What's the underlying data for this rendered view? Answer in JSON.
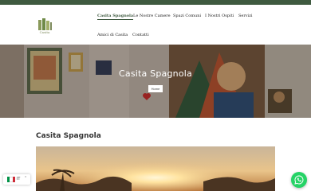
{
  "site": {
    "logo_text": "Casita"
  },
  "nav": {
    "items": [
      {
        "label": "Casita Spagnola",
        "active": true
      },
      {
        "label": "Le Nostre Camere",
        "active": false
      },
      {
        "label": "Spazi Comuni",
        "active": false
      },
      {
        "label": "I Nostri Ospiti",
        "active": false
      },
      {
        "label": "Servizi",
        "active": false
      },
      {
        "label": "Amici di Casita",
        "active": false
      },
      {
        "label": "Contatti",
        "active": false
      }
    ]
  },
  "hero": {
    "title": "Casita Spagnola",
    "breadcrumb": "Home"
  },
  "section": {
    "title": "Casita Spagnola"
  },
  "language": {
    "code": "IT",
    "chevron": "⌃",
    "flag_colors": [
      "#009246",
      "#ffffff",
      "#ce2b37"
    ]
  },
  "colors": {
    "brand_green": "#3f5a40",
    "whatsapp": "#25d366"
  }
}
